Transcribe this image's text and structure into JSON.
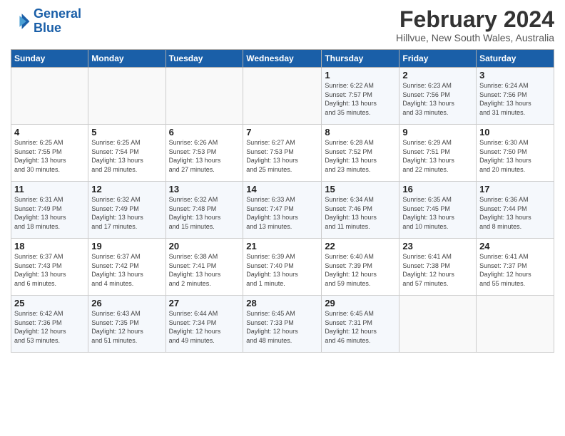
{
  "logo": {
    "line1": "General",
    "line2": "Blue"
  },
  "title": "February 2024",
  "location": "Hillvue, New South Wales, Australia",
  "weekdays": [
    "Sunday",
    "Monday",
    "Tuesday",
    "Wednesday",
    "Thursday",
    "Friday",
    "Saturday"
  ],
  "weeks": [
    [
      {
        "day": "",
        "detail": ""
      },
      {
        "day": "",
        "detail": ""
      },
      {
        "day": "",
        "detail": ""
      },
      {
        "day": "",
        "detail": ""
      },
      {
        "day": "1",
        "detail": "Sunrise: 6:22 AM\nSunset: 7:57 PM\nDaylight: 13 hours\nand 35 minutes."
      },
      {
        "day": "2",
        "detail": "Sunrise: 6:23 AM\nSunset: 7:56 PM\nDaylight: 13 hours\nand 33 minutes."
      },
      {
        "day": "3",
        "detail": "Sunrise: 6:24 AM\nSunset: 7:56 PM\nDaylight: 13 hours\nand 31 minutes."
      }
    ],
    [
      {
        "day": "4",
        "detail": "Sunrise: 6:25 AM\nSunset: 7:55 PM\nDaylight: 13 hours\nand 30 minutes."
      },
      {
        "day": "5",
        "detail": "Sunrise: 6:25 AM\nSunset: 7:54 PM\nDaylight: 13 hours\nand 28 minutes."
      },
      {
        "day": "6",
        "detail": "Sunrise: 6:26 AM\nSunset: 7:53 PM\nDaylight: 13 hours\nand 27 minutes."
      },
      {
        "day": "7",
        "detail": "Sunrise: 6:27 AM\nSunset: 7:53 PM\nDaylight: 13 hours\nand 25 minutes."
      },
      {
        "day": "8",
        "detail": "Sunrise: 6:28 AM\nSunset: 7:52 PM\nDaylight: 13 hours\nand 23 minutes."
      },
      {
        "day": "9",
        "detail": "Sunrise: 6:29 AM\nSunset: 7:51 PM\nDaylight: 13 hours\nand 22 minutes."
      },
      {
        "day": "10",
        "detail": "Sunrise: 6:30 AM\nSunset: 7:50 PM\nDaylight: 13 hours\nand 20 minutes."
      }
    ],
    [
      {
        "day": "11",
        "detail": "Sunrise: 6:31 AM\nSunset: 7:49 PM\nDaylight: 13 hours\nand 18 minutes."
      },
      {
        "day": "12",
        "detail": "Sunrise: 6:32 AM\nSunset: 7:49 PM\nDaylight: 13 hours\nand 17 minutes."
      },
      {
        "day": "13",
        "detail": "Sunrise: 6:32 AM\nSunset: 7:48 PM\nDaylight: 13 hours\nand 15 minutes."
      },
      {
        "day": "14",
        "detail": "Sunrise: 6:33 AM\nSunset: 7:47 PM\nDaylight: 13 hours\nand 13 minutes."
      },
      {
        "day": "15",
        "detail": "Sunrise: 6:34 AM\nSunset: 7:46 PM\nDaylight: 13 hours\nand 11 minutes."
      },
      {
        "day": "16",
        "detail": "Sunrise: 6:35 AM\nSunset: 7:45 PM\nDaylight: 13 hours\nand 10 minutes."
      },
      {
        "day": "17",
        "detail": "Sunrise: 6:36 AM\nSunset: 7:44 PM\nDaylight: 13 hours\nand 8 minutes."
      }
    ],
    [
      {
        "day": "18",
        "detail": "Sunrise: 6:37 AM\nSunset: 7:43 PM\nDaylight: 13 hours\nand 6 minutes."
      },
      {
        "day": "19",
        "detail": "Sunrise: 6:37 AM\nSunset: 7:42 PM\nDaylight: 13 hours\nand 4 minutes."
      },
      {
        "day": "20",
        "detail": "Sunrise: 6:38 AM\nSunset: 7:41 PM\nDaylight: 13 hours\nand 2 minutes."
      },
      {
        "day": "21",
        "detail": "Sunrise: 6:39 AM\nSunset: 7:40 PM\nDaylight: 13 hours\nand 1 minute."
      },
      {
        "day": "22",
        "detail": "Sunrise: 6:40 AM\nSunset: 7:39 PM\nDaylight: 12 hours\nand 59 minutes."
      },
      {
        "day": "23",
        "detail": "Sunrise: 6:41 AM\nSunset: 7:38 PM\nDaylight: 12 hours\nand 57 minutes."
      },
      {
        "day": "24",
        "detail": "Sunrise: 6:41 AM\nSunset: 7:37 PM\nDaylight: 12 hours\nand 55 minutes."
      }
    ],
    [
      {
        "day": "25",
        "detail": "Sunrise: 6:42 AM\nSunset: 7:36 PM\nDaylight: 12 hours\nand 53 minutes."
      },
      {
        "day": "26",
        "detail": "Sunrise: 6:43 AM\nSunset: 7:35 PM\nDaylight: 12 hours\nand 51 minutes."
      },
      {
        "day": "27",
        "detail": "Sunrise: 6:44 AM\nSunset: 7:34 PM\nDaylight: 12 hours\nand 49 minutes."
      },
      {
        "day": "28",
        "detail": "Sunrise: 6:45 AM\nSunset: 7:33 PM\nDaylight: 12 hours\nand 48 minutes."
      },
      {
        "day": "29",
        "detail": "Sunrise: 6:45 AM\nSunset: 7:31 PM\nDaylight: 12 hours\nand 46 minutes."
      },
      {
        "day": "",
        "detail": ""
      },
      {
        "day": "",
        "detail": ""
      }
    ]
  ]
}
